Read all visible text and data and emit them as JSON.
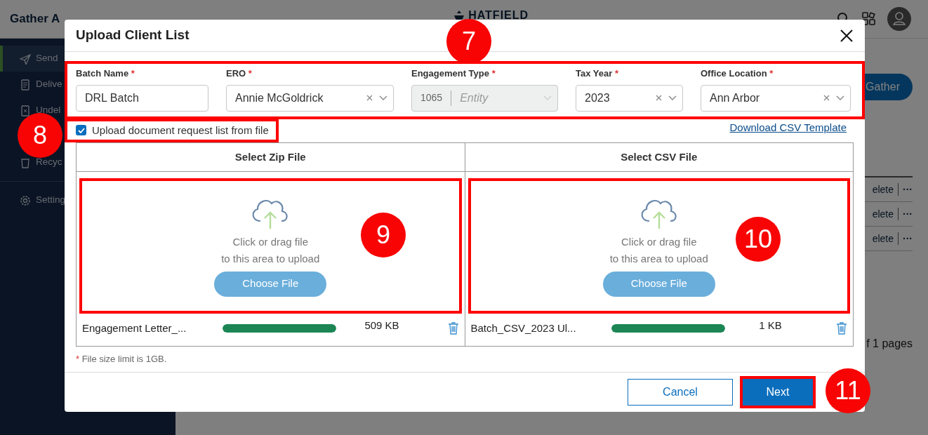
{
  "app": {
    "logo": "Gather A",
    "brand": "HATFIELD",
    "sidebar": {
      "items": [
        {
          "label": "Send",
          "selected": true
        },
        {
          "label": "Delive",
          "selected": false
        },
        {
          "label": "Undel",
          "selected": false
        },
        {
          "label": "Recyc",
          "selected": false
        }
      ],
      "footer_items": [
        {
          "label": "Setting",
          "selected": false
        }
      ]
    },
    "gather_button": "Gather",
    "rows": [
      {
        "action": "elete",
        "menu": "···"
      },
      {
        "action": "elete",
        "menu": "···"
      },
      {
        "action": "elete",
        "menu": "···"
      }
    ],
    "pagination": "f 1  pages"
  },
  "dialog": {
    "title": "Upload Client List",
    "fields": [
      {
        "kind": "input",
        "label": "Batch Name",
        "required": true,
        "value": "DRL Batch",
        "disabled": false
      },
      {
        "kind": "select",
        "label": "ERO",
        "required": true,
        "value": "Annie McGoldrick",
        "disabled": false
      },
      {
        "kind": "split",
        "label": "Engagement Type",
        "required": true,
        "value": "1065",
        "secondary": "Entity",
        "disabled": true
      },
      {
        "kind": "select",
        "label": "Tax Year",
        "required": true,
        "value": "2023",
        "disabled": false
      },
      {
        "kind": "select",
        "label": "Office Location",
        "required": true,
        "value": "Ann Arbor",
        "disabled": false
      }
    ],
    "upload_from_file": {
      "label": "Upload document request list from file",
      "checked": true
    },
    "template_link": "Download CSV Template",
    "panels": [
      {
        "heading": "Select Zip File",
        "drop_text": [
          "Click or drag file",
          "to this area to upload"
        ],
        "button": "Choose File",
        "file": {
          "name": "Engagement Letter_...",
          "level": 1,
          "size": "509 KB"
        }
      },
      {
        "heading": "Select CSV File",
        "drop_text": [
          "Click or drag file",
          "to this area to upload"
        ],
        "button": "Choose File",
        "file": {
          "name": "Batch_CSV_2023 Ul...",
          "level": 1,
          "size": "1 KB"
        }
      }
    ],
    "note": {
      "mark": "*",
      "text": "File size limit is 1GB."
    },
    "buttons": [
      {
        "label": "Cancel",
        "kind": "secondary"
      },
      {
        "label": "Next",
        "kind": "primary"
      }
    ]
  },
  "annotations": [
    {
      "number": "7"
    },
    {
      "number": "8"
    },
    {
      "number": "9"
    },
    {
      "number": "10"
    },
    {
      "number": "11"
    }
  ]
}
